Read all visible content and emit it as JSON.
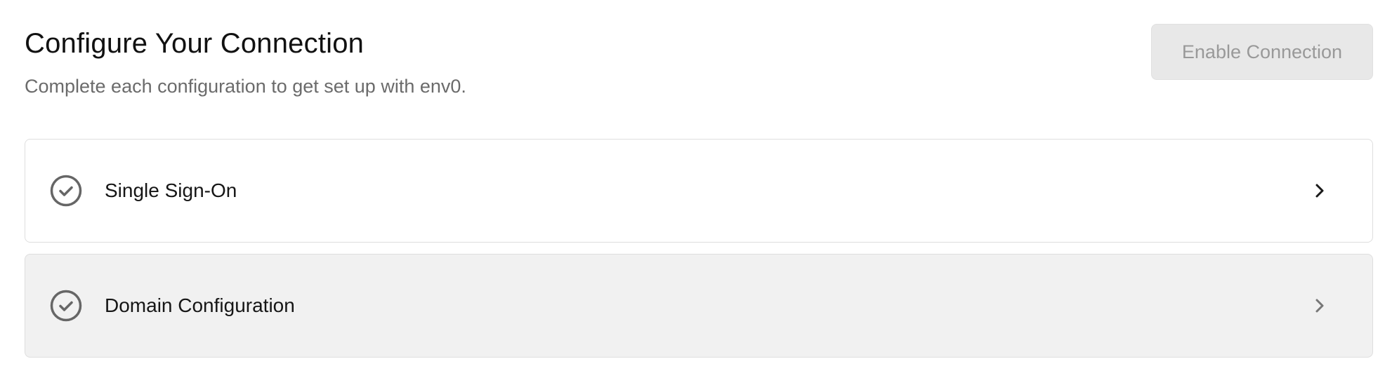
{
  "header": {
    "title": "Configure Your Connection",
    "subtitle": "Complete each configuration to get set up with env0."
  },
  "actions": {
    "enable_label": "Enable Connection",
    "enable_disabled": true
  },
  "configurations": [
    {
      "label": "Single Sign-On",
      "icon": "check-circle-icon",
      "status": "complete"
    },
    {
      "label": "Domain Configuration",
      "icon": "check-circle-icon",
      "status": "complete"
    }
  ],
  "colors": {
    "check_stroke": "#666666",
    "card_border": "#dedede",
    "card_muted_bg": "#f1f1f1",
    "button_disabled_bg": "#e8e8e8",
    "button_disabled_text": "#999999"
  }
}
